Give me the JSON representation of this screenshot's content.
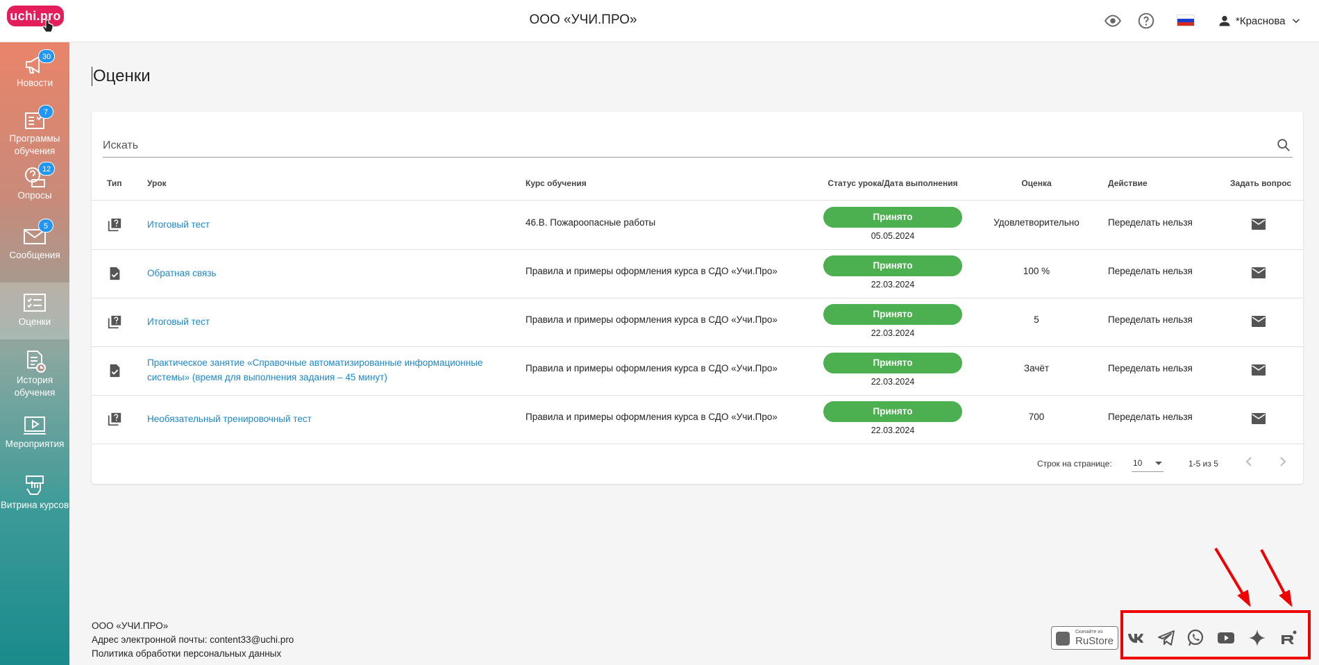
{
  "header": {
    "logo_text": "uchi.pro",
    "org_title": "ООО «УЧИ.ПРО»",
    "user_name": "*Краснова",
    "flag_colors": [
      "#ffffff",
      "#1c3ecf",
      "#d52b1e"
    ]
  },
  "sidebar": {
    "items": [
      {
        "label": "Новости",
        "badge": "30",
        "icon": "megaphone-icon"
      },
      {
        "label": "Программы обучения",
        "badge": "7",
        "icon": "programs-icon"
      },
      {
        "label": "Опросы",
        "badge": "12",
        "icon": "survey-icon"
      },
      {
        "label": "Сообщения",
        "badge": "5",
        "icon": "envelope-icon"
      },
      {
        "label": "Оценки",
        "badge": null,
        "icon": "grades-icon",
        "active": true
      },
      {
        "label": "История обучения",
        "badge": null,
        "icon": "history-icon"
      },
      {
        "label": "Мероприятия",
        "badge": null,
        "icon": "events-icon"
      },
      {
        "label": "Витрина курсов",
        "badge": null,
        "icon": "showcase-icon"
      }
    ]
  },
  "main": {
    "title": "Оценки",
    "search_placeholder": "Искать",
    "columns": [
      "Тип",
      "Урок",
      "Курс обучения",
      "Статус урока/Дата выполнения",
      "Оценка",
      "Действие",
      "Задать вопрос"
    ],
    "rows": [
      {
        "type": "quiz",
        "lesson": "Итоговый тест",
        "course": "46.В. Пожароопасные работы",
        "status": "Принято",
        "date": "05.05.2024",
        "grade": "Удовлетворительно",
        "action": "Переделать нельзя"
      },
      {
        "type": "task",
        "lesson": "Обратная связь",
        "course": "Правила и примеры оформления курса в СДО «Учи.Про»",
        "status": "Принято",
        "date": "22.03.2024",
        "grade": "100 %",
        "action": "Переделать нельзя"
      },
      {
        "type": "quiz",
        "lesson": "Итоговый тест",
        "course": "Правила и примеры оформления курса в СДО «Учи.Про»",
        "status": "Принято",
        "date": "22.03.2024",
        "grade": "5",
        "action": "Переделать нельзя"
      },
      {
        "type": "task",
        "lesson": "Практическое занятие «Справочные автоматизированные информационные системы» (время для выполнения задания – 45 минут)",
        "course": "Правила и примеры оформления курса в СДО «Учи.Про»",
        "status": "Принято",
        "date": "22.03.2024",
        "grade": "Зачёт",
        "action": "Переделать нельзя"
      },
      {
        "type": "quiz",
        "lesson": "Необязательный тренировочный тест",
        "course": "Правила и примеры оформления курса в СДО «Учи.Про»",
        "status": "Принято",
        "date": "22.03.2024",
        "grade": "700",
        "action": "Переделать нельзя"
      }
    ],
    "pager": {
      "rows_label": "Строк на странице:",
      "rows_value": "10",
      "range": "1-5 из 5"
    }
  },
  "footer": {
    "line1": "ООО «УЧИ.ПРО»",
    "line2": "Адрес электронной почты: content33@uchi.pro",
    "line3": "Политика обработки персональных данных",
    "rustore_small": "Скачайте из",
    "rustore_big": "RuStore",
    "social": [
      "vk-icon",
      "telegram-icon",
      "whatsapp-icon",
      "youtube-icon",
      "sparkle-icon",
      "rutube-icon"
    ]
  },
  "colors": {
    "accent_link": "#1e88c8",
    "status_green": "#4caf50",
    "badge_blue": "#2196f3",
    "logo_pink": "#e41e5b",
    "annotation_red": "#f00000"
  }
}
